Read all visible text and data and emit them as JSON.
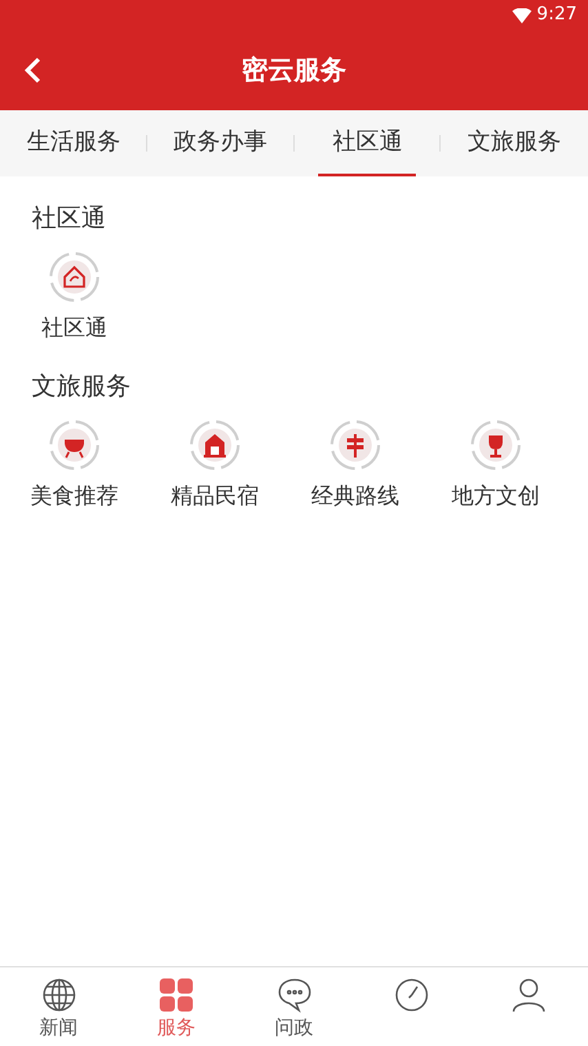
{
  "status_bar": {
    "time": "9:27"
  },
  "header": {
    "title": "密云服务"
  },
  "tabs": [
    {
      "label": "生活服务",
      "selected": false
    },
    {
      "label": "政务办事",
      "selected": false
    },
    {
      "label": "社区通",
      "selected": true
    },
    {
      "label": "文旅服务",
      "selected": false
    }
  ],
  "sections": [
    {
      "title": "社区通",
      "items": [
        {
          "label": "社区通",
          "kind": "house"
        }
      ]
    },
    {
      "title": "文旅服务",
      "items": [
        {
          "label": "美食推荐",
          "kind": "grill"
        },
        {
          "label": "精品民宿",
          "kind": "lodge"
        },
        {
          "label": "经典路线",
          "kind": "signpost"
        },
        {
          "label": "地方文创",
          "kind": "trophy"
        }
      ]
    }
  ],
  "bottom_nav": [
    {
      "label": "新闻",
      "kind": "globe",
      "selected": false
    },
    {
      "label": "服务",
      "kind": "grid",
      "selected": true
    },
    {
      "label": "问政",
      "kind": "chat",
      "selected": false
    },
    {
      "kind": "dial",
      "selected": false
    },
    {
      "kind": "person",
      "selected": false
    }
  ]
}
